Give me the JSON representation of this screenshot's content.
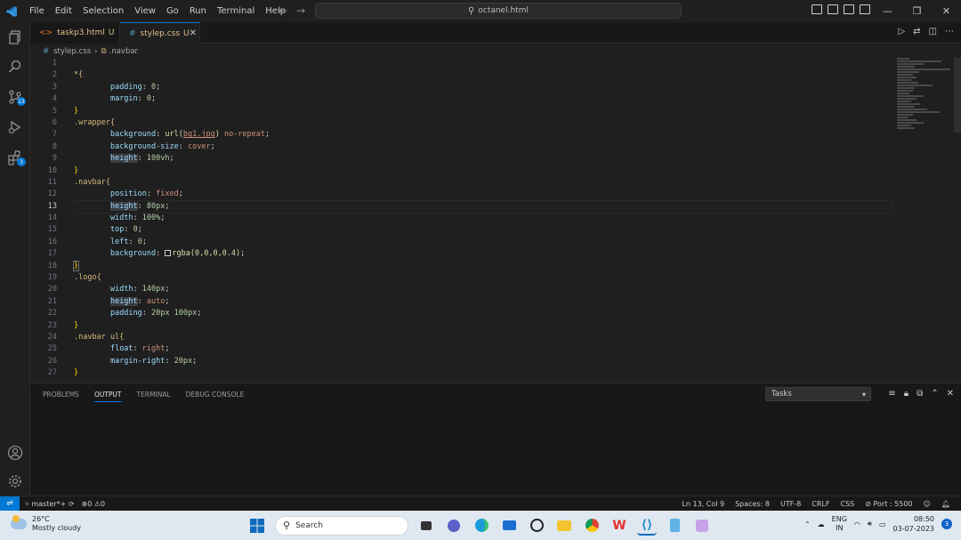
{
  "titlebar": {
    "menu": [
      "File",
      "Edit",
      "Selection",
      "View",
      "Go",
      "Run",
      "Terminal",
      "Help"
    ],
    "command_center": "octanel.html"
  },
  "activity": {
    "source_control_badge": "13",
    "extensions_badge": "3"
  },
  "tabs": [
    {
      "label": "taskp3.html",
      "status": "U",
      "icon": "html-file-icon"
    },
    {
      "label": "stylep.css",
      "status": "U",
      "icon": "css-file-icon"
    }
  ],
  "breadcrumb": {
    "file": "stylep.css",
    "symbol": ".navbar"
  },
  "editor": {
    "line_numbers": [
      "1",
      "2",
      "3",
      "4",
      "5",
      "6",
      "7",
      "8",
      "9",
      "10",
      "11",
      "12",
      "13",
      "14",
      "15",
      "16",
      "17",
      "18",
      "19",
      "20",
      "21",
      "22",
      "23",
      "24",
      "25",
      "26",
      "27"
    ],
    "current_line": "13",
    "code": {
      "l2_sel": "*{",
      "l3_prop": "padding",
      "l3_val": "0",
      "l4_prop": "margin",
      "l4_val": "0",
      "l5": "}",
      "l6_sel": ".wrapper{",
      "l7_prop": "background",
      "l7_fn": "url(",
      "l7_url": "bg1.jpg",
      "l7_close": ")",
      "l7_val": "no-repeat",
      "l8_prop": "background-size",
      "l8_val": "cover",
      "l9_prop": "height",
      "l9_val": "100vh",
      "l10": "}",
      "l11_sel": ".navbar{",
      "l12_prop": "position",
      "l12_val": "fixed",
      "l13_prop": "height",
      "l13_val": "80px",
      "l14_prop": "width",
      "l14_val": "100%",
      "l15_prop": "top",
      "l15_val": "0",
      "l16_prop": "left",
      "l16_val": "0",
      "l17_prop": "background",
      "l17_val": "rgba(0,0,0,0.4)",
      "l18": "}",
      "l19_sel": ".logo{",
      "l20_prop": "width",
      "l20_val": "140px",
      "l21_prop": "height",
      "l21_val": "auto",
      "l22_prop": "padding",
      "l22_val": "20px 100px",
      "l23": "}",
      "l24_sel": ".navbar ul{",
      "l25_prop": "float",
      "l25_val": "right",
      "l26_prop": "margin-right",
      "l26_val": "20px",
      "l27": "}"
    }
  },
  "panel": {
    "tabs": [
      "PROBLEMS",
      "OUTPUT",
      "TERMINAL",
      "DEBUG CONSOLE"
    ],
    "active_tab": "OUTPUT",
    "task_select": "Tasks"
  },
  "statusbar": {
    "branch": "master*+",
    "errors": "0",
    "warnings": "0",
    "position": "Ln 13, Col 9",
    "spaces": "Spaces: 8",
    "encoding": "UTF-8",
    "eol": "CRLF",
    "language": "CSS",
    "port": "Port : 5500"
  },
  "taskbar": {
    "weather_temp": "26°C",
    "weather_desc": "Mostly cloudy",
    "search_placeholder": "Search",
    "lang_line1": "ENG",
    "lang_line2": "IN",
    "time": "08:50",
    "date": "03-07-2023",
    "notification_count": "3"
  }
}
